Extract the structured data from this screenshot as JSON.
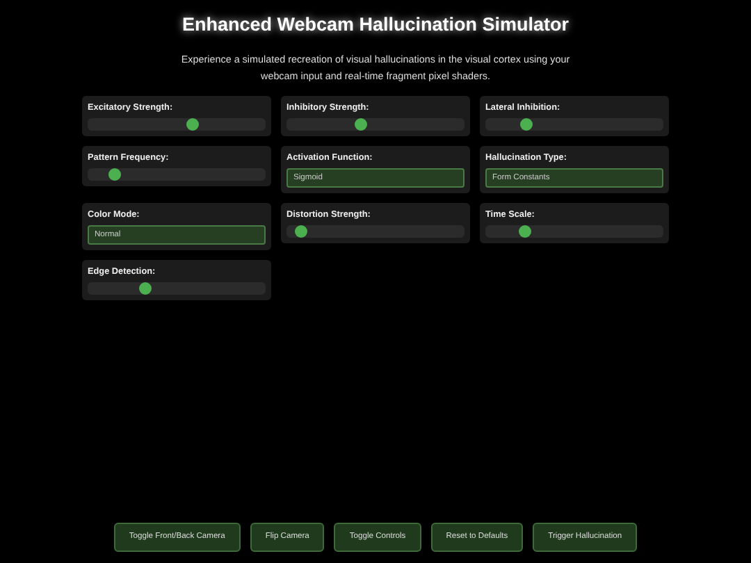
{
  "title": "Enhanced Webcam Hallucination Simulator",
  "description": "Experience a simulated recreation of visual hallucinations in the visual cortex using your webcam input and real-time fragment pixel shaders.",
  "controls": [
    {
      "kind": "slider",
      "label": "Excitatory Strength:",
      "level": 0.6
    },
    {
      "kind": "slider",
      "label": "Inhibitory Strength:",
      "level": 0.41
    },
    {
      "kind": "slider",
      "label": "Lateral Inhibition:",
      "level": 0.21
    },
    {
      "kind": "slider",
      "label": "Pattern Frequency:",
      "level": 0.13
    },
    {
      "kind": "select",
      "label": "Activation Function:",
      "value": "Sigmoid"
    },
    {
      "kind": "select",
      "label": "Hallucination Type:",
      "value": "Form Constants"
    },
    {
      "kind": "select",
      "label": "Color Mode:",
      "value": "Normal"
    },
    {
      "kind": "slider",
      "label": "Distortion Strength:",
      "level": 0.05
    },
    {
      "kind": "slider",
      "label": "Time Scale:",
      "level": 0.2
    },
    {
      "kind": "slider",
      "label": "Edge Detection:",
      "level": 0.31
    }
  ],
  "buttons": [
    "Toggle Front/Back Camera",
    "Flip Camera",
    "Toggle Controls",
    "Reset to Defaults",
    "Trigger Hallucination"
  ]
}
